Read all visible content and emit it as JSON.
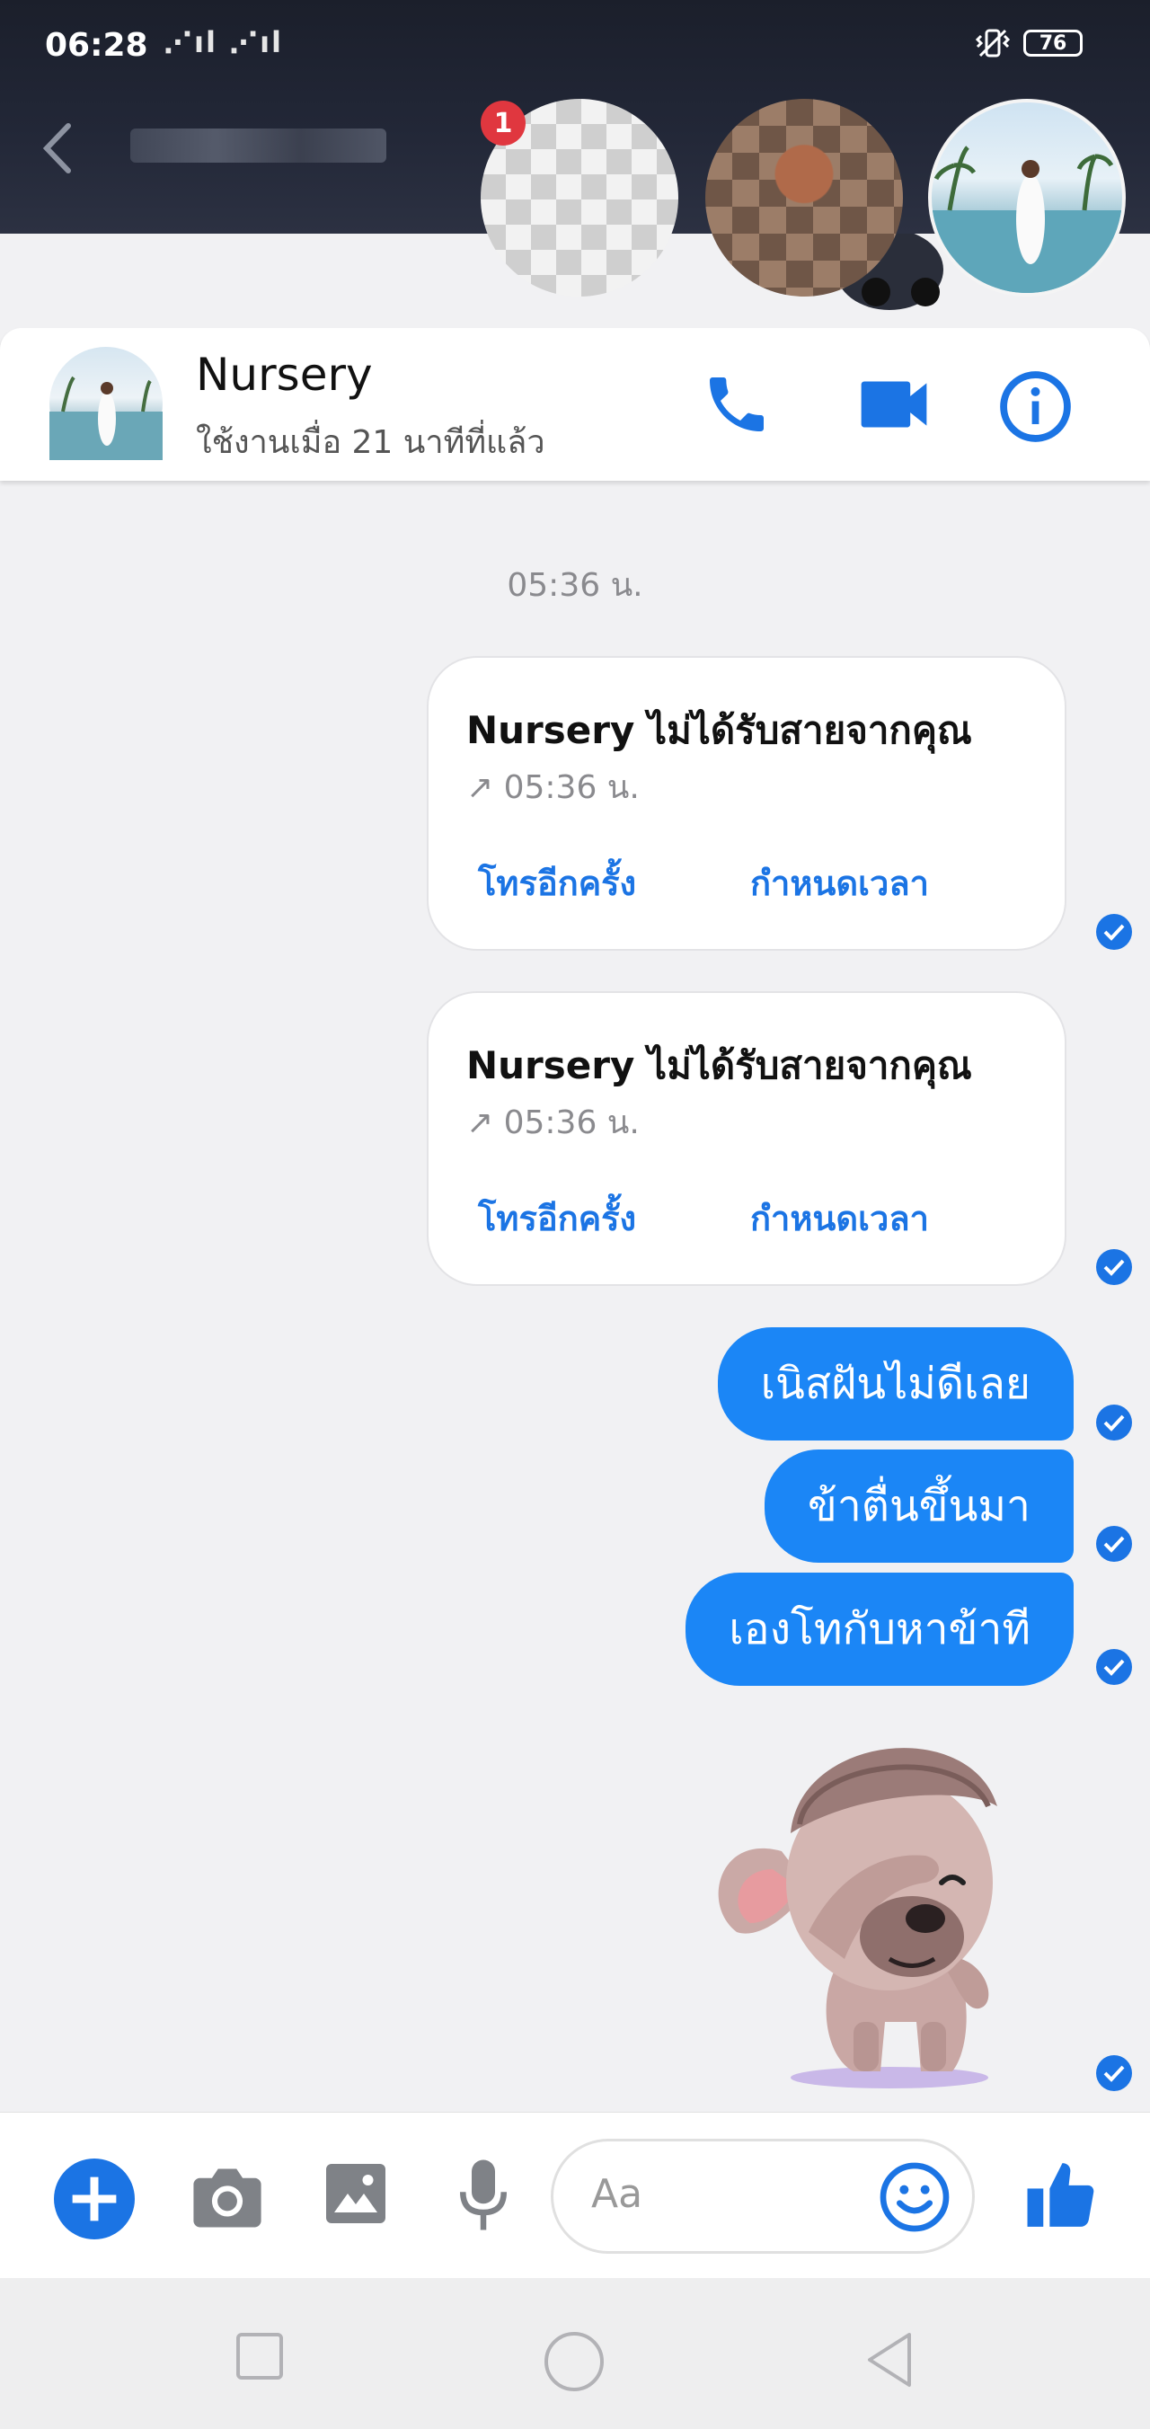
{
  "status_bar": {
    "time": "06:28",
    "signal": " ▐▌ ▐▌",
    "battery": "76"
  },
  "chat_heads": {
    "badge_count": "1"
  },
  "header": {
    "contact_name": "Nursery",
    "active_status": "ใช้งานเมื่อ 21 นาทีที่แล้ว"
  },
  "conversation": {
    "timestamp": "05:36 น.",
    "missed_calls": [
      {
        "title": "Nursery ไม่ได้รับสายจากคุณ",
        "time": "05:36 น.",
        "call_again": "โทรอีกครั้ง",
        "schedule": "กำหนดเวลา"
      },
      {
        "title": "Nursery ไม่ได้รับสายจากคุณ",
        "time": "05:36 น.",
        "call_again": "โทรอีกครั้ง",
        "schedule": "กำหนดเวลา"
      }
    ],
    "messages": [
      "เนิสฝันไม่ดีเลย",
      "ข้าตื่นขึ้นมา",
      "เองโทกับหาข้าที"
    ]
  },
  "composer": {
    "placeholder": "Aa"
  },
  "colors": {
    "accent": "#1b86f6",
    "link": "#1b74e4",
    "badge": "#e0373f"
  },
  "icons": [
    "back-chevron-icon",
    "phone-icon",
    "video-camera-icon",
    "info-icon",
    "plus-icon",
    "camera-icon",
    "image-icon",
    "microphone-icon",
    "emoji-icon",
    "thumbs-up-icon",
    "read-receipt-icon",
    "nav-recents-icon",
    "nav-home-icon",
    "nav-back-icon"
  ]
}
